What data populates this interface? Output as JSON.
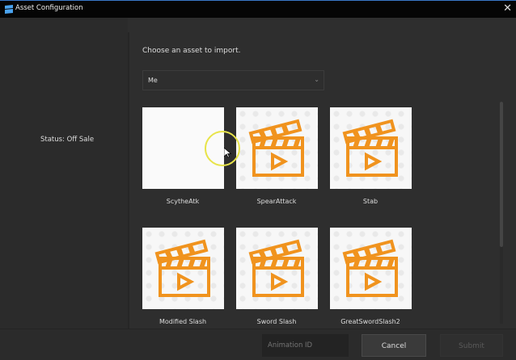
{
  "window": {
    "title": "Asset Configuration",
    "close_icon": "close-icon"
  },
  "sidebar": {
    "status": "Status: Off Sale"
  },
  "main": {
    "prompt": "Choose an asset to import.",
    "creator_dropdown": {
      "value": "Me"
    },
    "assets": [
      {
        "name": "ScytheAtk",
        "thumbnail": "blank"
      },
      {
        "name": "SpearAttack",
        "thumbnail": "clapperboard-icon"
      },
      {
        "name": "Stab",
        "thumbnail": "clapperboard-icon"
      },
      {
        "name": "Modified Slash",
        "thumbnail": "clapperboard-icon"
      },
      {
        "name": "Sword Slash",
        "thumbnail": "clapperboard-icon"
      },
      {
        "name": "GreatSwordSlash2",
        "thumbnail": "clapperboard-icon"
      }
    ]
  },
  "footer": {
    "animation_id_placeholder": "Animation ID",
    "cancel_label": "Cancel",
    "submit_label": "Submit"
  },
  "colors": {
    "accent_orange": "#f0931e",
    "titlebar": "#050505",
    "background": "#2e2e2e"
  }
}
